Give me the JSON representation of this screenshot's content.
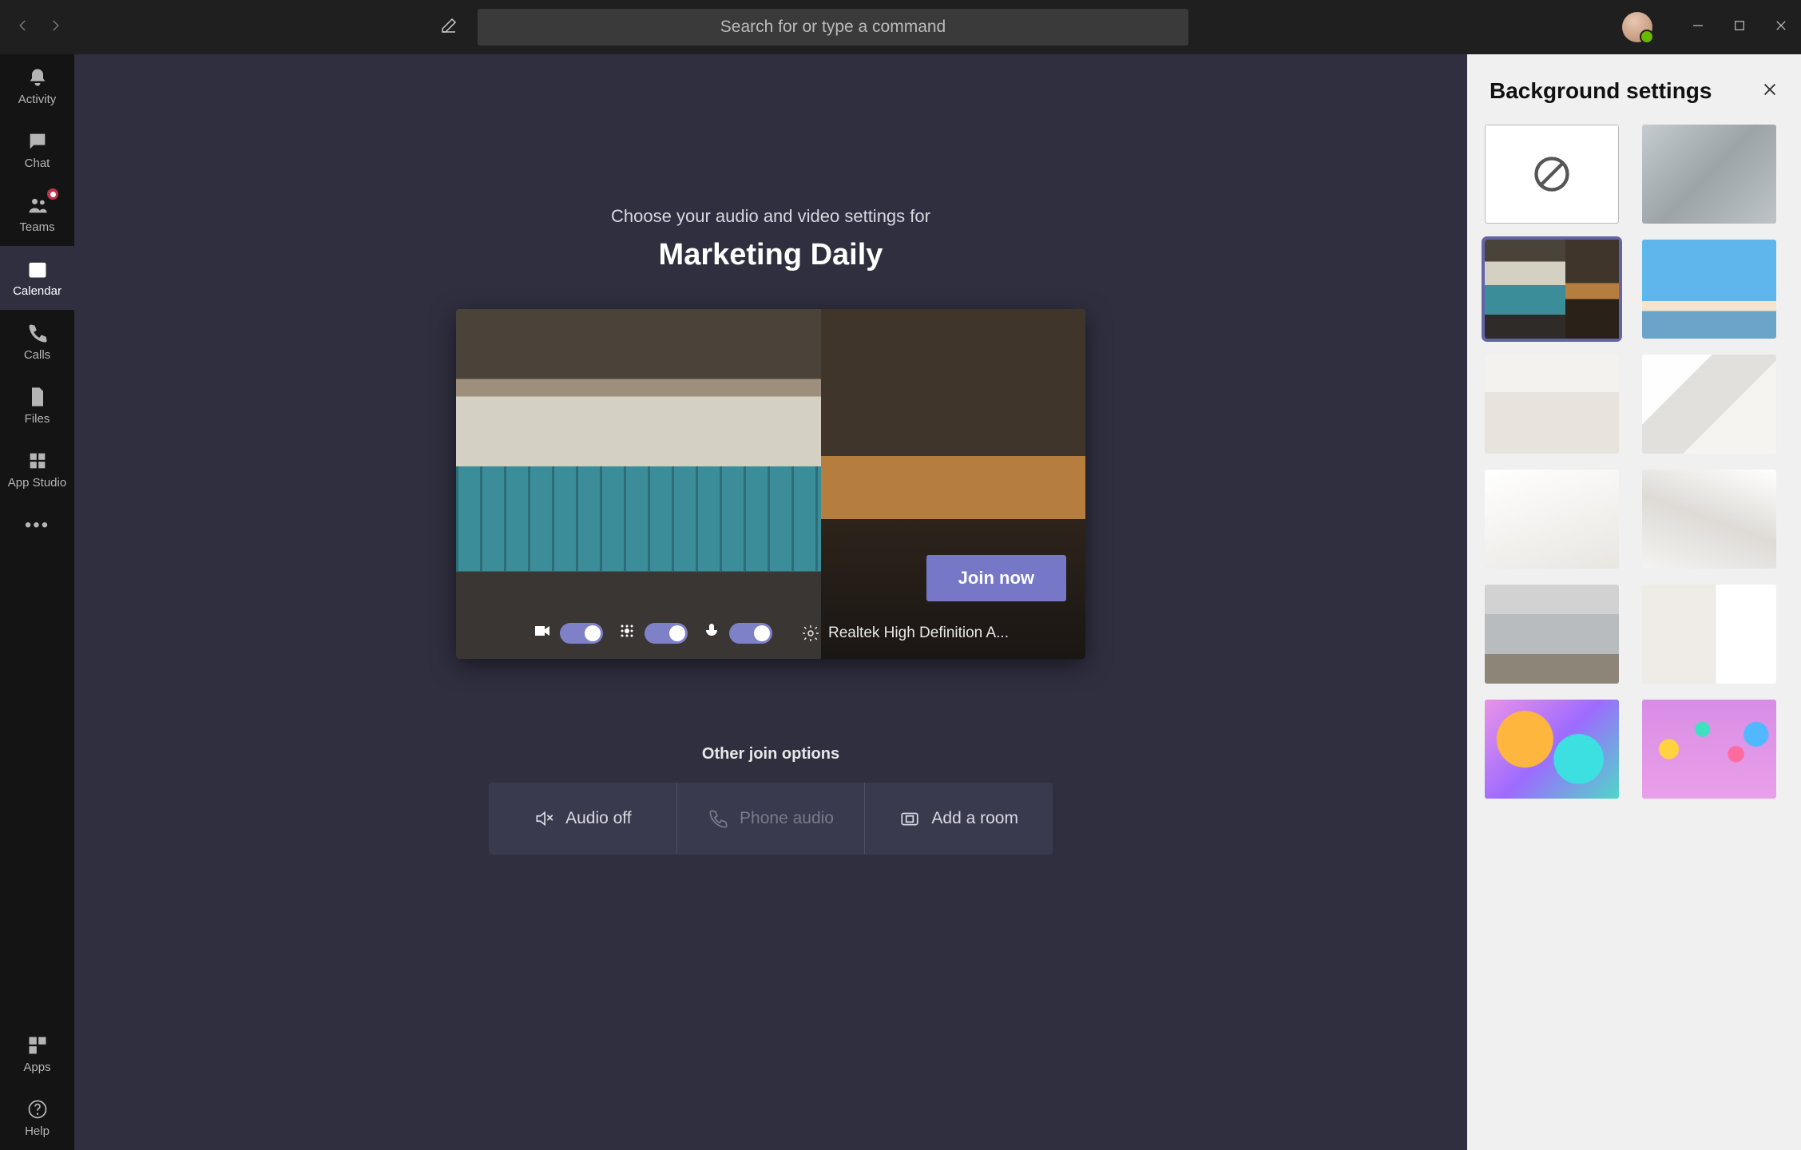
{
  "titlebar": {
    "search_placeholder": "Search for or type a command"
  },
  "sidebar": {
    "items": [
      {
        "id": "activity",
        "label": "Activity"
      },
      {
        "id": "chat",
        "label": "Chat"
      },
      {
        "id": "teams",
        "label": "Teams",
        "badge": true
      },
      {
        "id": "calendar",
        "label": "Calendar",
        "active": true
      },
      {
        "id": "calls",
        "label": "Calls"
      },
      {
        "id": "files",
        "label": "Files"
      },
      {
        "id": "app-studio",
        "label": "App Studio"
      }
    ],
    "bottom": [
      {
        "id": "apps",
        "label": "Apps"
      },
      {
        "id": "help",
        "label": "Help"
      }
    ]
  },
  "prejoin": {
    "blurb": "Choose your audio and video settings for",
    "meeting_title": "Marketing Daily",
    "join_label": "Join now",
    "device_label": "Realtek High Definition A...",
    "other_title": "Other join options",
    "options": [
      {
        "id": "audio-off",
        "label": "Audio off"
      },
      {
        "id": "phone-audio",
        "label": "Phone audio",
        "disabled": true
      },
      {
        "id": "add-room",
        "label": "Add a room"
      }
    ]
  },
  "panel": {
    "title": "Background settings",
    "tiles": [
      {
        "id": "none",
        "kind": "none"
      },
      {
        "id": "blur",
        "kind": "blur"
      },
      {
        "id": "lockers",
        "kind": "image",
        "selected": true
      },
      {
        "id": "beach",
        "kind": "image"
      },
      {
        "id": "room-a",
        "kind": "image"
      },
      {
        "id": "room-b",
        "kind": "image"
      },
      {
        "id": "room-c",
        "kind": "image"
      },
      {
        "id": "room-d",
        "kind": "image"
      },
      {
        "id": "loft",
        "kind": "image"
      },
      {
        "id": "room-e",
        "kind": "image"
      },
      {
        "id": "balloons-a",
        "kind": "image"
      },
      {
        "id": "balloons-b",
        "kind": "image"
      }
    ]
  },
  "colors": {
    "accent": "#6264A7",
    "app_bg": "#2F2F40",
    "sidebar_bg": "#141414"
  }
}
